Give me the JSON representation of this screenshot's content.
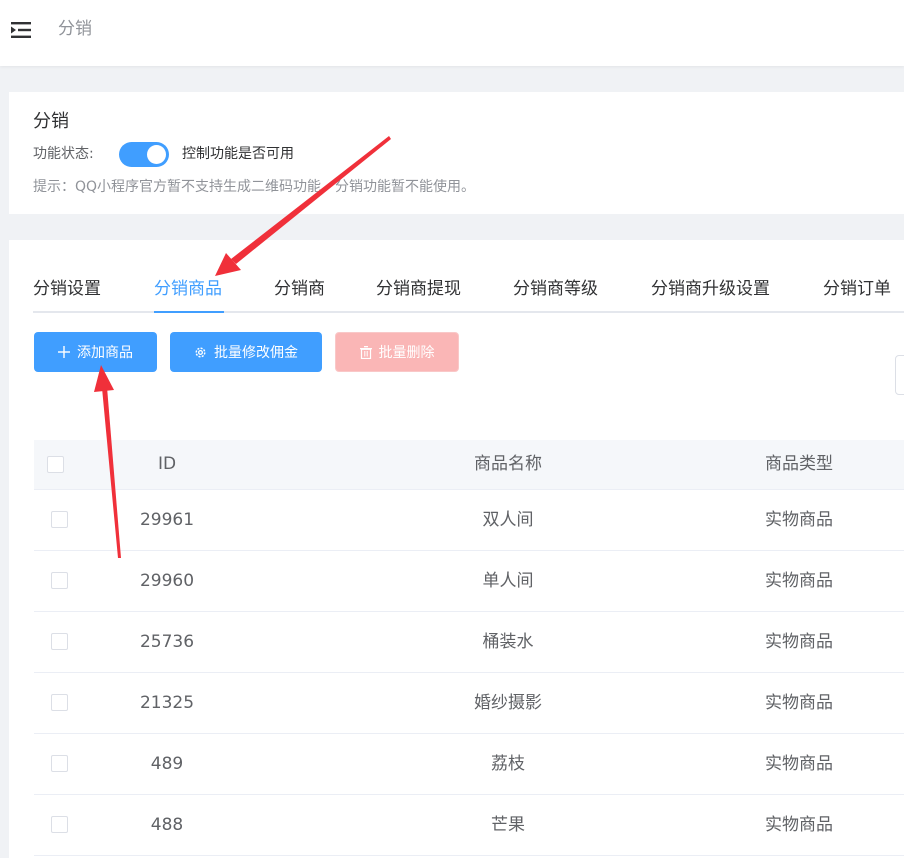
{
  "header": {
    "title": "分销"
  },
  "feature": {
    "title": "分销",
    "status_label": "功能状态:",
    "switch_on": true,
    "switch_desc": "控制功能是否可用",
    "tip": "提示：QQ小程序官方暂不支持生成二维码功能，分销功能暂不能使用。"
  },
  "tabs": [
    {
      "label": "分销设置",
      "active": false
    },
    {
      "label": "分销商品",
      "active": true
    },
    {
      "label": "分销商",
      "active": false
    },
    {
      "label": "分销商提现",
      "active": false
    },
    {
      "label": "分销商等级",
      "active": false
    },
    {
      "label": "分销商升级设置",
      "active": false
    },
    {
      "label": "分销订单",
      "active": false
    }
  ],
  "toolbar": {
    "add_label": "添加商品",
    "commission_label": "批量修改佣金",
    "delete_label": "批量删除"
  },
  "table": {
    "columns": [
      "ID",
      "商品名称",
      "商品类型"
    ],
    "rows": [
      {
        "id": "29961",
        "name": "双人间",
        "type": "实物商品"
      },
      {
        "id": "29960",
        "name": "单人间",
        "type": "实物商品"
      },
      {
        "id": "25736",
        "name": "桶装水",
        "type": "实物商品"
      },
      {
        "id": "21325",
        "name": "婚纱摄影",
        "type": "实物商品"
      },
      {
        "id": "489",
        "name": "荔枝",
        "type": "实物商品"
      },
      {
        "id": "488",
        "name": "芒果",
        "type": "实物商品"
      }
    ]
  },
  "colors": {
    "primary": "#409eff",
    "danger_disabled": "#fab6b6",
    "annotation_arrow": "#f0303a"
  },
  "icons": {
    "menu": "menu-fold-icon",
    "add": "plus-icon",
    "commission": "gear-icon",
    "delete": "trash-icon"
  }
}
